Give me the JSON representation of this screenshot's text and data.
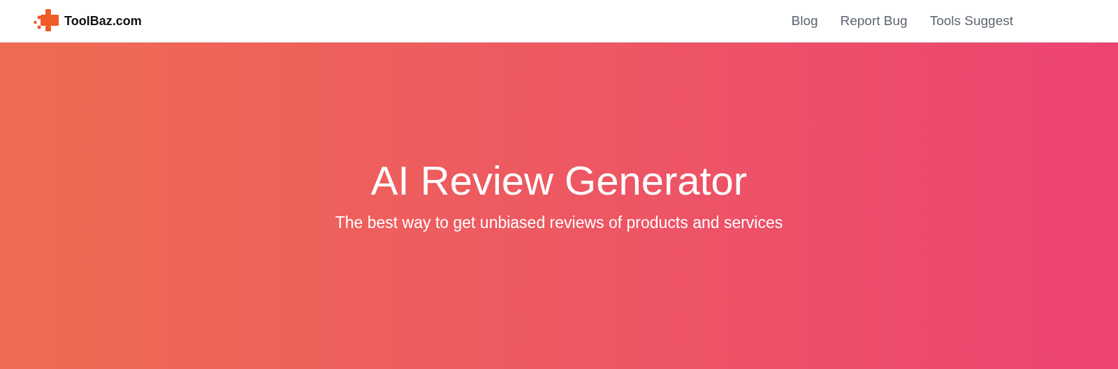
{
  "brand": {
    "name": "ToolBaz.com"
  },
  "nav_links": [
    {
      "label": "Blog"
    },
    {
      "label": "Report Bug"
    },
    {
      "label": "Tools Suggest"
    }
  ],
  "hero": {
    "title": "AI Review Generator",
    "subtitle": "The best way to get unbiased reviews of products and services"
  }
}
